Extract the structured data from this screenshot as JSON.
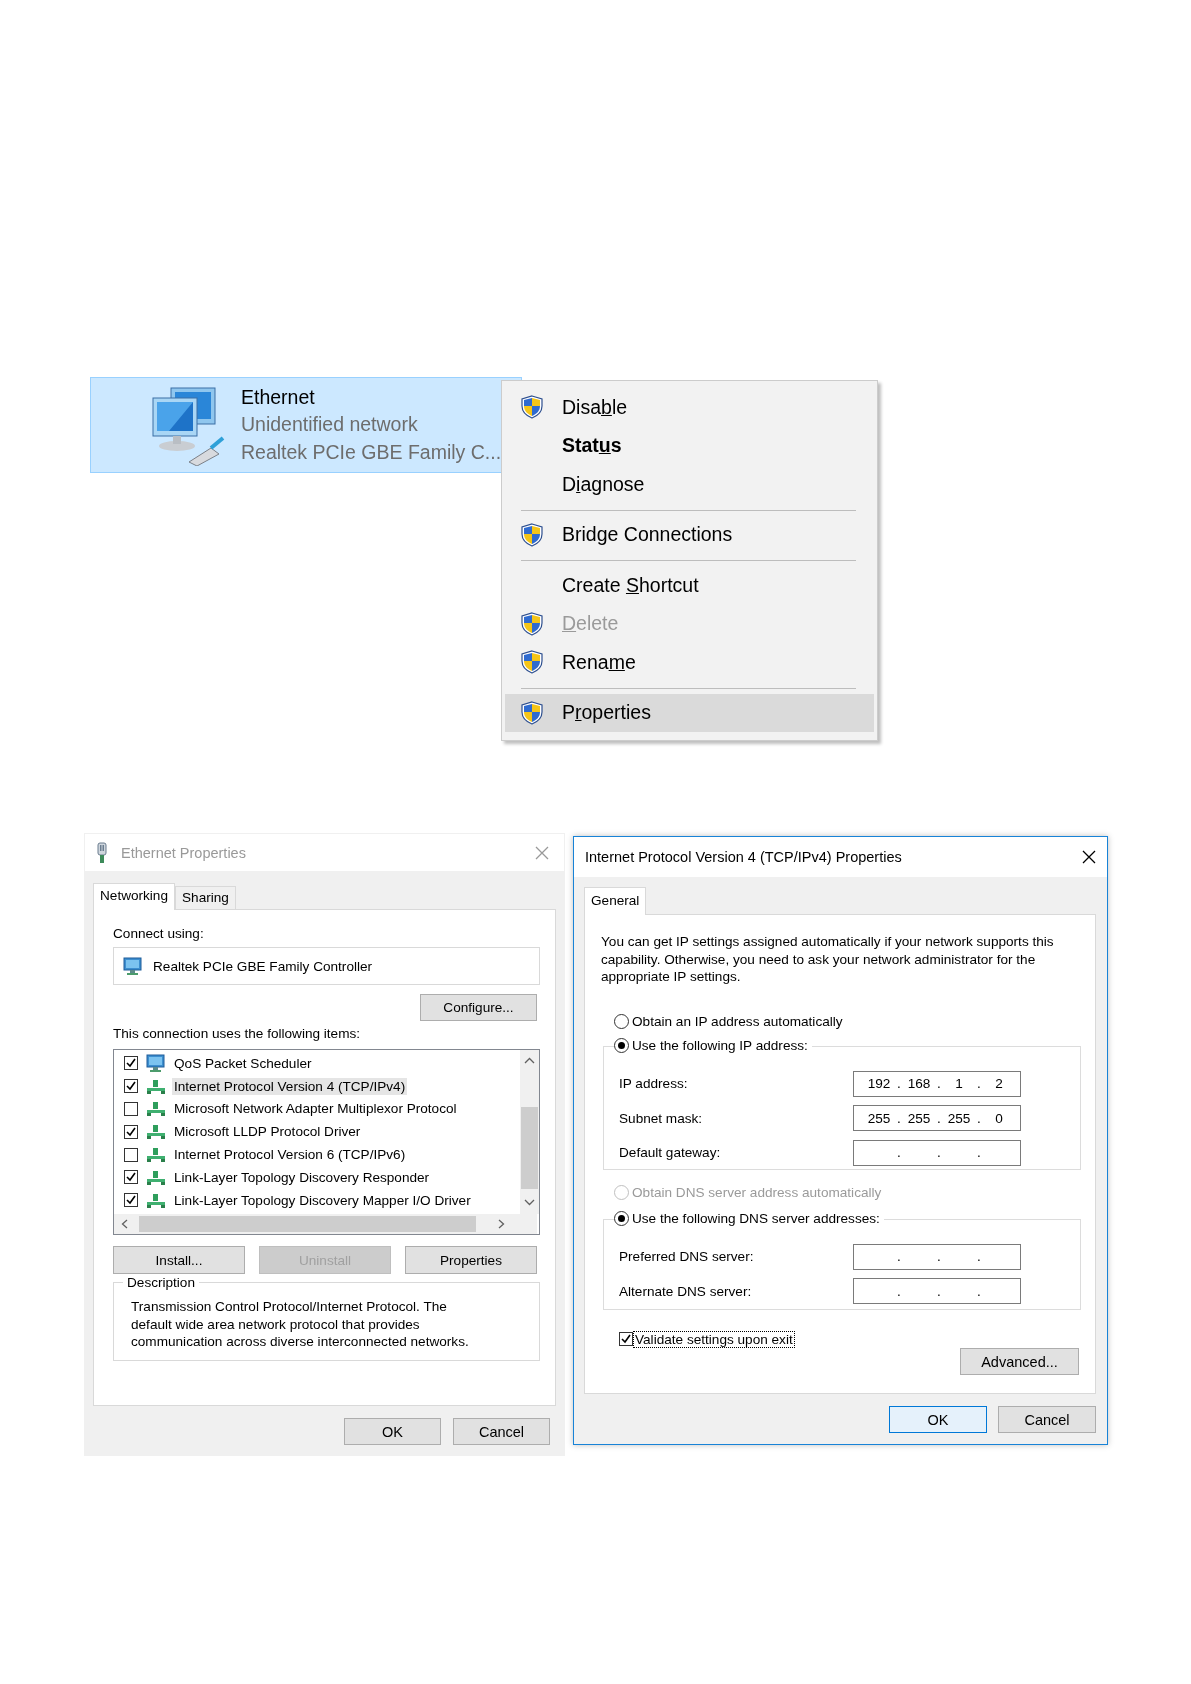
{
  "connection": {
    "name": "Ethernet",
    "status": "Unidentified network",
    "adapter": "Realtek PCIe GBE Family C...",
    "selected": true
  },
  "context_menu": {
    "items": [
      {
        "kind": "item",
        "text_before": "Disa",
        "access_key": "b",
        "text_after": "le",
        "shield": true,
        "default": false,
        "disabled": false,
        "highlighted": false
      },
      {
        "kind": "item",
        "text_before": "Stat",
        "access_key": "u",
        "text_after": "s",
        "shield": false,
        "default": true,
        "disabled": false,
        "highlighted": false
      },
      {
        "kind": "item",
        "text_before": "D",
        "access_key": "i",
        "text_after": "agnose",
        "shield": false,
        "default": false,
        "disabled": false,
        "highlighted": false
      },
      {
        "kind": "separator"
      },
      {
        "kind": "item",
        "text_before": "Brid",
        "access_key": "g",
        "text_after": "e Connections",
        "shield": true,
        "default": false,
        "disabled": false,
        "highlighted": false
      },
      {
        "kind": "separator"
      },
      {
        "kind": "item",
        "text_before": "Create ",
        "access_key": "S",
        "text_after": "hortcut",
        "shield": false,
        "default": false,
        "disabled": false,
        "highlighted": false
      },
      {
        "kind": "item",
        "access_key": "D",
        "text_after": "elete",
        "shield": true,
        "default": false,
        "disabled": true,
        "highlighted": false
      },
      {
        "kind": "item",
        "text_before": "Rena",
        "access_key": "m",
        "text_after": "e",
        "shield": true,
        "default": false,
        "disabled": false,
        "highlighted": false
      },
      {
        "kind": "separator"
      },
      {
        "kind": "item",
        "text_before": "P",
        "access_key": "r",
        "text_after": "operties",
        "shield": true,
        "default": false,
        "disabled": false,
        "highlighted": true
      }
    ]
  },
  "ethernet_properties": {
    "title": "Ethernet Properties",
    "active": false,
    "tabs": [
      {
        "label": "Networking",
        "selected": true
      },
      {
        "label": "Sharing",
        "selected": false
      }
    ],
    "connect_using_label": "Connect using:",
    "adapter": "Realtek PCIe GBE Family Controller",
    "configure_button": "Configure...",
    "items_label": "This connection uses the following items:",
    "items": [
      {
        "kind": "scheduler",
        "label": "QoS Packet Scheduler",
        "checked": true,
        "selected": false
      },
      {
        "kind": "protocol",
        "label": "Internet Protocol Version 4 (TCP/IPv4)",
        "checked": true,
        "selected": true
      },
      {
        "kind": "protocol",
        "label": "Microsoft Network Adapter Multiplexor Protocol",
        "checked": false,
        "selected": false
      },
      {
        "kind": "protocol",
        "label": "Microsoft LLDP Protocol Driver",
        "checked": true,
        "selected": false
      },
      {
        "kind": "protocol",
        "label": "Internet Protocol Version 6 (TCP/IPv6)",
        "checked": false,
        "selected": false
      },
      {
        "kind": "protocol",
        "label": "Link-Layer Topology Discovery Responder",
        "checked": true,
        "selected": false
      },
      {
        "kind": "protocol",
        "label": "Link-Layer Topology Discovery Mapper I/O Driver",
        "checked": true,
        "selected": false
      }
    ],
    "buttons": [
      {
        "label": "Install...",
        "disabled": false
      },
      {
        "label": "Uninstall",
        "disabled": true
      },
      {
        "label": "Properties",
        "disabled": false
      }
    ],
    "description": {
      "title": "Description",
      "text": "Transmission Control Protocol/Internet Protocol. The default wide area network protocol that provides communication across diverse interconnected networks."
    },
    "footer_buttons": [
      {
        "label": "OK",
        "default": false
      },
      {
        "label": "Cancel",
        "default": false
      }
    ]
  },
  "ipv4_properties": {
    "title": "Internet Protocol Version 4 (TCP/IPv4) Properties",
    "active": true,
    "tabs": [
      {
        "label": "General",
        "selected": true
      }
    ],
    "intro": "You can get IP settings assigned automatically if your network supports this capability. Otherwise, you need to ask your network administrator for the appropriate IP settings.",
    "ip_auto": {
      "label": "Obtain an IP address automatically",
      "selected": false,
      "disabled": false
    },
    "ip_manual": {
      "label": "Use the following IP address:",
      "selected": true,
      "disabled": false
    },
    "ip_fields": [
      {
        "label": "IP address:",
        "octets": [
          "192",
          "168",
          "1",
          "2"
        ],
        "dots": [
          ".",
          ".",
          "."
        ]
      },
      {
        "label": "Subnet mask:",
        "octets": [
          "255",
          "255",
          "255",
          "0"
        ],
        "dots": [
          ".",
          ".",
          "."
        ]
      },
      {
        "label": "Default gateway:",
        "dots": [
          ".",
          ".",
          "."
        ]
      }
    ],
    "dns_auto": {
      "label": "Obtain DNS server address automatically",
      "selected": false,
      "disabled": true
    },
    "dns_manual": {
      "label": "Use the following DNS server addresses:",
      "selected": true,
      "disabled": false
    },
    "dns_fields": [
      {
        "label": "Preferred DNS server:",
        "dots": [
          ".",
          ".",
          "."
        ]
      },
      {
        "label": "Alternate DNS server:",
        "dots": [
          ".",
          ".",
          "."
        ]
      }
    ],
    "validate": {
      "label": "Validate settings upon exit",
      "checked": true,
      "focused": true
    },
    "advanced_button": "Advanced...",
    "footer_buttons": [
      {
        "label": "OK",
        "default": true
      },
      {
        "label": "Cancel",
        "default": false
      }
    ]
  }
}
